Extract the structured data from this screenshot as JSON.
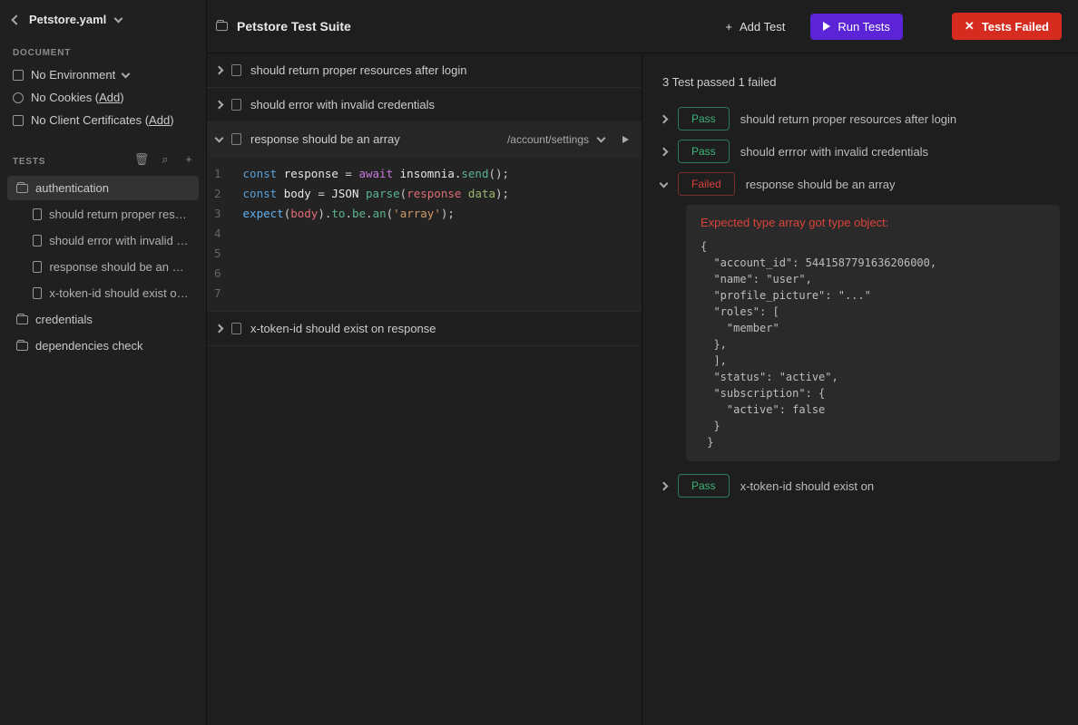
{
  "header": {
    "filename": "Petstore.yaml"
  },
  "document": {
    "section_label": "DOCUMENT",
    "env_label": "No Environment",
    "cookies_label": "No Cookies (",
    "cookies_add": "Add",
    "cookies_close": ")",
    "cert_label": "No Client Certificates (",
    "cert_add": "Add",
    "cert_close": ")"
  },
  "tests_section": {
    "label": "TESTS",
    "folders": [
      {
        "name": "authentication",
        "active": true,
        "children": [
          "should return proper resourc...",
          "should error with invalid cre...",
          "response should be an array",
          "x-token-id should exist on r..."
        ]
      },
      {
        "name": "credentials",
        "active": false,
        "children": []
      },
      {
        "name": "dependencies check",
        "active": false,
        "children": []
      }
    ]
  },
  "suite": {
    "title": "Petstore Test Suite",
    "add_test": "Add Test",
    "run_tests": "Run Tests",
    "tests_failed": "Tests Failed"
  },
  "test_list": [
    {
      "title": "should return proper resources after login",
      "expanded": false
    },
    {
      "title": "should error with invalid credentials",
      "expanded": false
    },
    {
      "title": "response should be an array",
      "expanded": true,
      "url": "/account/settings"
    },
    {
      "title": "x-token-id should exist on response",
      "expanded": false
    }
  ],
  "code": {
    "gutter": [
      "1",
      "2",
      "3",
      "4",
      "5",
      "6",
      "7"
    ],
    "line1": {
      "p1": "const ",
      "p2": "response",
      "p3": " = ",
      "p4": "await ",
      "p5": "insomnia.",
      "p6": "send",
      "p7": "();"
    },
    "line2": {
      "p1": "const ",
      "p2": "body",
      "p3": " = ",
      "p4": "JSON ",
      "p5": "parse",
      "p6": "(",
      "p7": "response ",
      "p8": "data",
      "p9": ");"
    },
    "line3": {
      "p1": "expect",
      "p2": "(",
      "p3": "body",
      "p4": ").",
      "p5": "to",
      "p6": ".",
      "p7": "be",
      "p8": ".",
      "p9": "an",
      "p10": "(",
      "p11": "'array'",
      "p12": ");"
    }
  },
  "results": {
    "summary": "3 Test passed 1 failed",
    "rows": [
      {
        "status": "Pass",
        "label": "should return proper resources after login"
      },
      {
        "status": "Pass",
        "label": "should errror with invalid credentials"
      },
      {
        "status": "Failed",
        "label": "response should be an array",
        "expanded": true,
        "error_msg": "Expected type array got type object:",
        "error_json": "{\n  \"account_id\": 5441587791636206000,\n  \"name\": \"user\",\n  \"profile_picture\": \"...\"\n  \"roles\": [\n    \"member\"\n  },\n  ],\n  \"status\": \"active\",\n  \"subscription\": {\n    \"active\": false\n  }\n }"
      },
      {
        "status": "Pass",
        "label": "x-token-id should exist on"
      }
    ]
  }
}
